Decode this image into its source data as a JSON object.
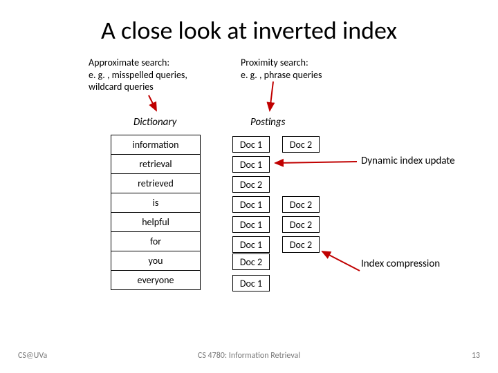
{
  "title": "A close look at inverted index",
  "subheads": {
    "left": "Approximate search:\ne. g. , misspelled queries, wildcard queries",
    "right": "Proximity search:\ne. g. , phrase queries"
  },
  "column_headers": {
    "dictionary": "Dictionary",
    "postings": "Postings"
  },
  "dictionary": [
    "information",
    "retrieval",
    "retrieved",
    "is",
    "helpful",
    "for",
    "you",
    "everyone"
  ],
  "postings": [
    [
      "Doc 1",
      "Doc 2"
    ],
    [
      "Doc 1"
    ],
    [
      "Doc 2"
    ],
    [
      "Doc 1",
      "Doc 2"
    ],
    [
      "Doc 1",
      "Doc 2"
    ],
    [
      "Doc 1",
      "Doc 2"
    ],
    [
      "Doc 2"
    ],
    [
      "Doc 1"
    ]
  ],
  "annotations": {
    "dynamic": "Dynamic index update",
    "compression": "Index compression"
  },
  "footer": {
    "left": "CS@UVa",
    "mid": "CS 4780: Information Retrieval",
    "right": "13"
  }
}
